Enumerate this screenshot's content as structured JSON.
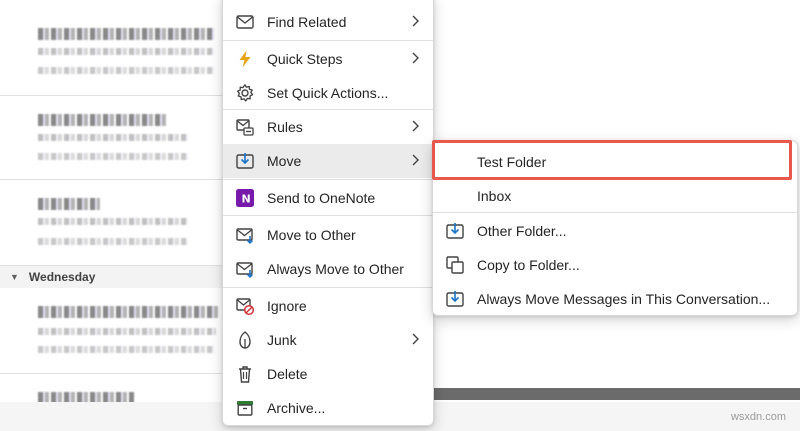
{
  "message_list": {
    "group_header": "Wednesday"
  },
  "context_menu": {
    "items": [
      {
        "label": "Find Related",
        "icon": "find-related-icon",
        "has_submenu": true
      },
      {
        "label": "Quick Steps",
        "icon": "lightning-icon",
        "has_submenu": true
      },
      {
        "label": "Set Quick Actions...",
        "icon": "gear-icon",
        "has_submenu": false
      },
      {
        "label": "Rules",
        "icon": "rules-icon",
        "has_submenu": true
      },
      {
        "label": "Move",
        "icon": "move-icon",
        "has_submenu": true
      },
      {
        "label": "Send to OneNote",
        "icon": "onenote-icon",
        "has_submenu": false
      },
      {
        "label": "Move to Other",
        "icon": "move-to-other-icon",
        "has_submenu": false
      },
      {
        "label": "Always Move to Other",
        "icon": "always-move-to-other-icon",
        "has_submenu": false
      },
      {
        "label": "Ignore",
        "icon": "ignore-icon",
        "has_submenu": false
      },
      {
        "label": "Junk",
        "icon": "junk-icon",
        "has_submenu": true
      },
      {
        "label": "Delete",
        "icon": "trash-icon",
        "has_submenu": false
      },
      {
        "label": "Archive...",
        "icon": "archive-icon",
        "has_submenu": false
      }
    ],
    "selected": "Move"
  },
  "move_submenu": {
    "items": [
      {
        "label": "Test Folder",
        "icon": ""
      },
      {
        "label": "Inbox",
        "icon": ""
      },
      {
        "label": "Other Folder...",
        "icon": "folder-move-icon"
      },
      {
        "label": "Copy to Folder...",
        "icon": "folder-copy-icon"
      },
      {
        "label": "Always Move Messages in This Conversation...",
        "icon": "folder-move-always-icon"
      }
    ],
    "highlighted": "Test Folder"
  },
  "colors": {
    "highlight_border": "#e9594b",
    "onenote_purple": "#7719aa",
    "lightning_orange": "#e8a317",
    "archive_green": "#2e7d32",
    "ignore_red": "#d13438"
  },
  "watermark": "wsxdn.com"
}
